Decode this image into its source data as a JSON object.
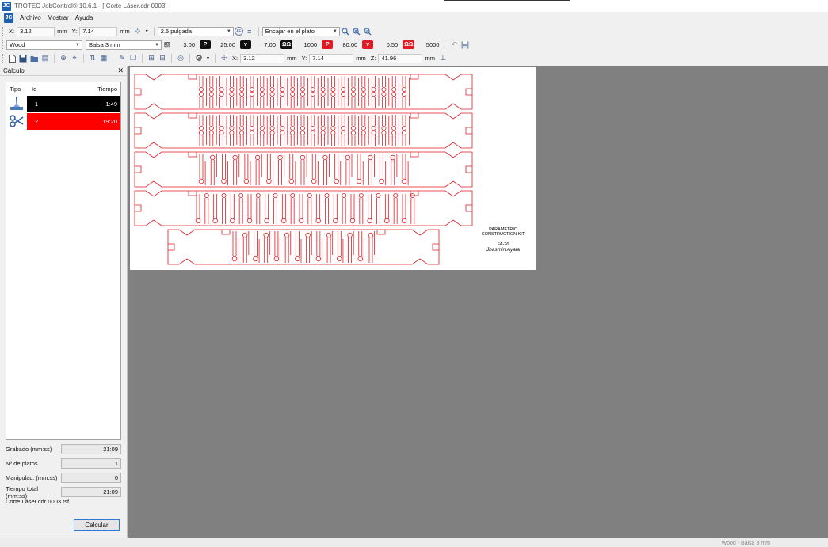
{
  "window": {
    "title": "TROTEC JobControl® 10.6.1 - [ Corte Láser.cdr 0003]"
  },
  "menu": {
    "items": [
      "Archivo",
      "Mostrar",
      "Ayuda"
    ]
  },
  "toolbar1": {
    "x_label": "X:",
    "x_value": "3.12",
    "x_unit": "mm",
    "y_label": "Y:",
    "y_value": "7.14",
    "y_unit": "mm",
    "lens": "2.5 pulgada",
    "af_label": "AF",
    "fit": "Encajar en el plato"
  },
  "toolbar2": {
    "material_group": "Wood",
    "material": "Balsa 3 mm",
    "thickness": "3.00",
    "p1": "25.00",
    "v1": "7.00",
    "f1": "1000",
    "p2": "80.00",
    "v2": "0.50",
    "f2": "5000",
    "p_label": "P",
    "v_label": "v",
    "f_label": "ΩΩ"
  },
  "toolbar3": {
    "x_label": "X:",
    "x_value": "3.12",
    "x_unit": "mm",
    "y_label": "Y:",
    "y_value": "7.14",
    "y_unit": "mm",
    "z_label": "Z:",
    "z_value": "41.96",
    "z_unit": "mm"
  },
  "panel": {
    "title": "Cálculo",
    "headers": {
      "type": "Tipo",
      "id": "Id",
      "time": "Tiempo"
    },
    "rows": [
      {
        "id": "1",
        "time": "1:49",
        "type_icon": "engrave-icon"
      },
      {
        "id": "2",
        "time": "19:20",
        "type_icon": "scissors-icon"
      }
    ],
    "stats": [
      {
        "label": "Grabado (mm:ss)",
        "value": "21:09"
      },
      {
        "label": "Nº de platos",
        "value": "1"
      },
      {
        "label": "Manipulac. (mm:ss)",
        "value": "0"
      },
      {
        "label": "Tiempo total (mm:ss)",
        "value": "21:09"
      }
    ],
    "file": "Corte Láser.cdr 0003.tsf",
    "calc_button": "Calcular"
  },
  "plate": {
    "text1": "PARAMETRIC",
    "text2": "CONSTRUCTION KIT",
    "text3": "FA-26",
    "text4": "Jhasmin Ayala"
  },
  "status": {
    "material": "Wood - Balsa 3 mm"
  },
  "colors": {
    "cut": "#e01b24",
    "workspace": "#808080",
    "accent": "#2b78d6"
  }
}
